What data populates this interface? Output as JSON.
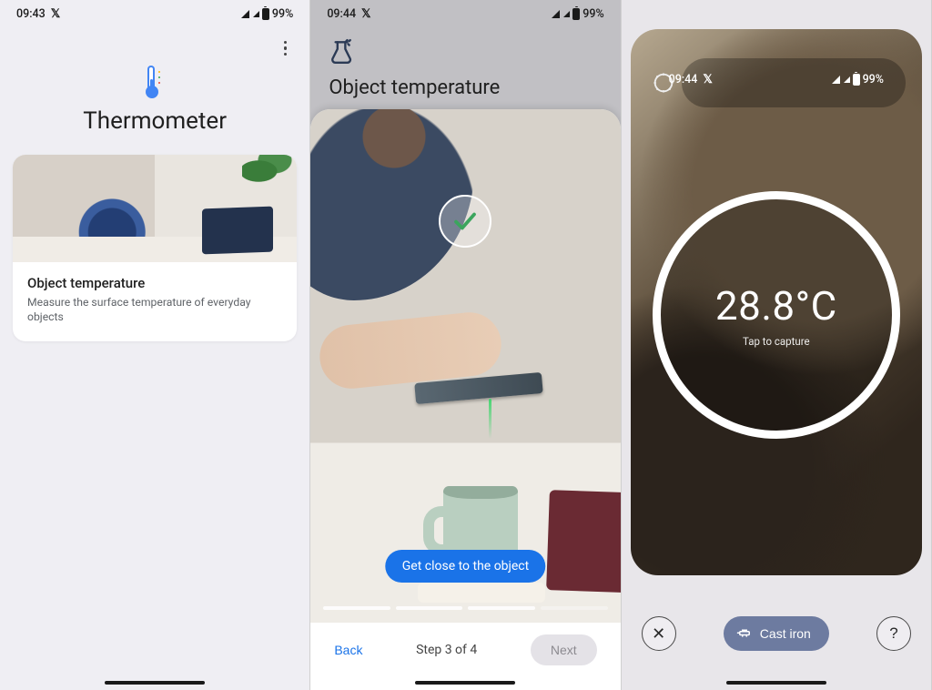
{
  "screen1": {
    "status": {
      "time": "09:43",
      "battery": "99%"
    },
    "title": "Thermometer",
    "card": {
      "title": "Object temperature",
      "subtitle": "Measure the surface temperature of everyday objects"
    }
  },
  "screen2": {
    "status": {
      "time": "09:44",
      "battery": "99%"
    },
    "heading": "Object temperature",
    "tip": "Get close to the object",
    "step_label": "Step 3 of 4",
    "back": "Back",
    "next": "Next",
    "step_current": 3,
    "step_total": 4
  },
  "screen3": {
    "status": {
      "time": "09:44",
      "battery": "99%"
    },
    "temperature": "28.8°C",
    "hint": "Tap to capture",
    "material": "Cast iron"
  }
}
